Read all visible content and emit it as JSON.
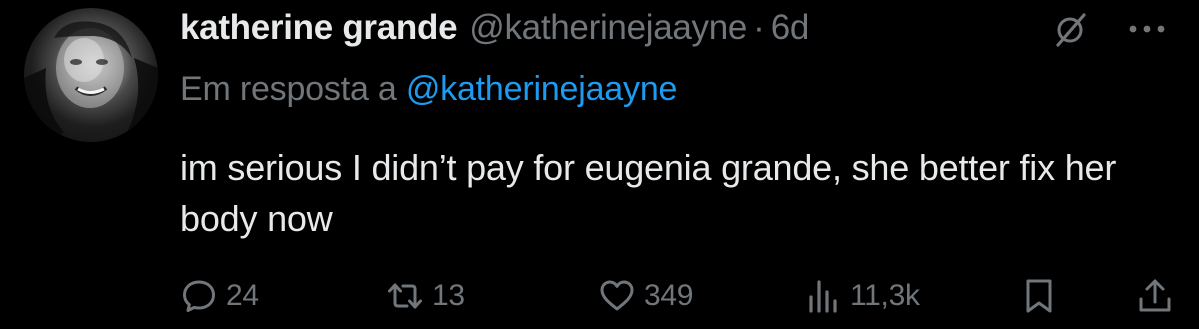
{
  "tweet": {
    "author": {
      "display_name": "katherine grande",
      "handle": "@katherinejaayne",
      "timestamp": "6d"
    },
    "separator": "·",
    "reply_context": {
      "prefix": "Em resposta a",
      "handle": "@katherinejaayne"
    },
    "text": "im serious I didn’t pay for eugenia grande, she better fix her body now",
    "actions": {
      "replies": "24",
      "reposts": "13",
      "likes": "349",
      "views": "11,3k"
    }
  },
  "icons": {
    "grok": "grok-icon",
    "more": "more-horizontal-icon",
    "reply": "reply-icon",
    "repost": "repost-icon",
    "like": "heart-icon",
    "views": "views-icon",
    "bookmark": "bookmark-icon",
    "share": "share-icon"
  },
  "colors": {
    "background": "#000000",
    "primary_text": "#e7e9ea",
    "secondary_text": "#71767b",
    "link": "#1d9bf0"
  }
}
